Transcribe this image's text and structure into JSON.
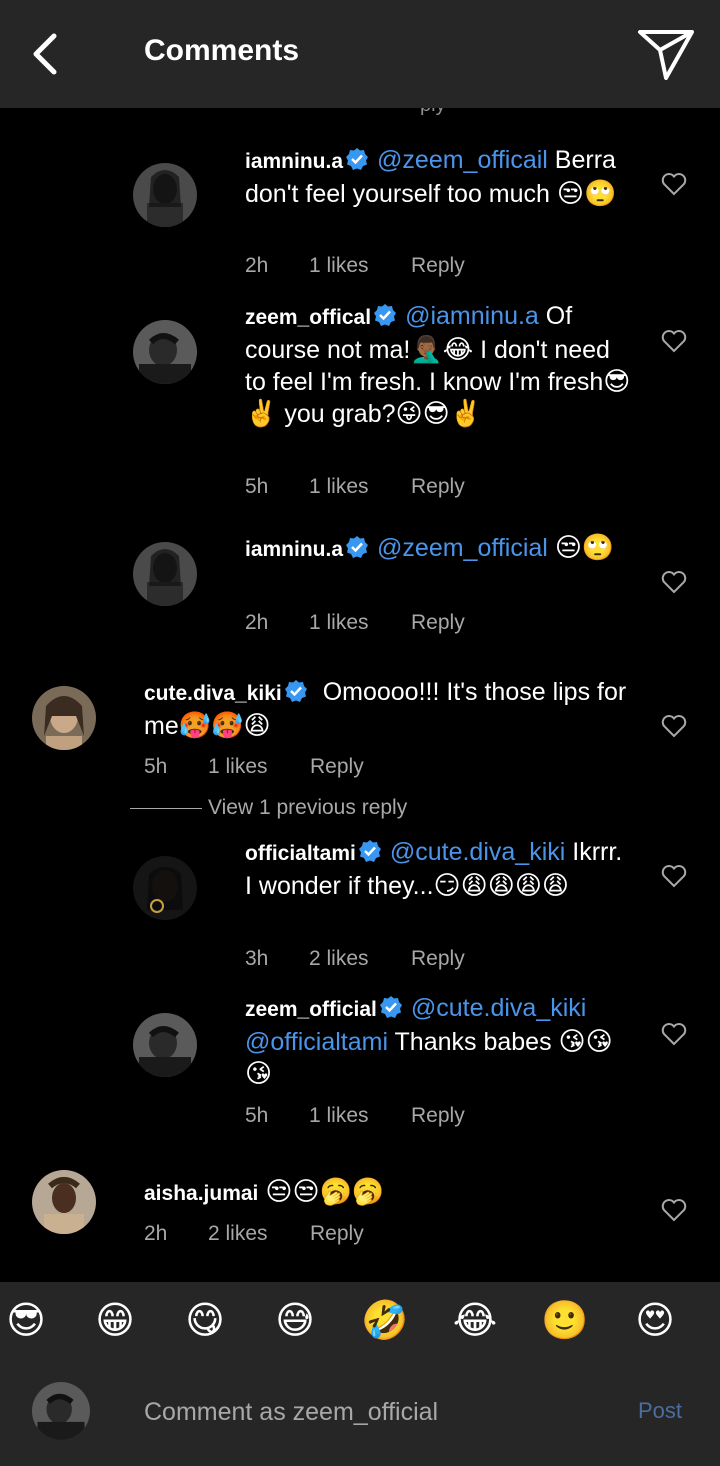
{
  "header": {
    "title": "Comments"
  },
  "list": {
    "cut_text": "ply",
    "view_previous": "View 1 previous reply",
    "comments": [
      {
        "user": "iamninu.a",
        "mention": "@zeem_officail",
        "text": " Berra don't feel yourself too much ",
        "emoji": "😒🙄",
        "time": "2h",
        "likes": "1 likes",
        "reply": "Reply"
      },
      {
        "user": "zeem_offical",
        "mention": "@iamninu.a",
        "text": " Of course not ma!",
        "emoji1": "🤦🏾‍♂️😂",
        "text2": " I don't need to feel I'm fresh. I know I'm fresh",
        "emoji2": "😎✌️",
        "text3": " you grab?",
        "emoji3": "😜😎✌️",
        "time": "5h",
        "likes": "1 likes",
        "reply": "Reply"
      },
      {
        "user": "iamninu.a",
        "mention": "@zeem_official",
        "text": " ",
        "emoji": "😒🙄",
        "time": "2h",
        "likes": "1 likes",
        "reply": "Reply"
      },
      {
        "user": "cute.diva_kiki",
        "text": " Omoooo!!! It's those lips for me",
        "emoji": "🥵🥵😩",
        "time": "5h",
        "likes": "1 likes",
        "reply": "Reply"
      },
      {
        "user": "officialtami",
        "mention": "@cute.diva_kiki",
        "text": " Ikrrr. I wonder if they...",
        "emoji": "😏😩😩😩😩",
        "time": "3h",
        "likes": "2 likes",
        "reply": "Reply"
      },
      {
        "user": "zeem_official",
        "mention": "@cute.diva_kiki",
        "mention2": "@officialtami",
        "text": " Thanks babes ",
        "emoji": "😘😘😘",
        "time": "5h",
        "likes": "1 likes",
        "reply": "Reply"
      },
      {
        "user": "aisha.jumai",
        "text": " ",
        "emoji": "😒😒🥱🥱",
        "time": "2h",
        "likes": "2 likes",
        "reply": "Reply"
      }
    ]
  },
  "emoji_bar": [
    "😎",
    "😁",
    "😋",
    "😅",
    "🤣",
    "😂",
    "🙂",
    "😍"
  ],
  "composer": {
    "placeholder": "Comment as zeem_official",
    "post_label": "Post"
  },
  "colors": {
    "header_bg": "#262626",
    "mention": "#4a95ea",
    "verified": "#3897f0",
    "post_disabled": "#4a6ea0"
  }
}
